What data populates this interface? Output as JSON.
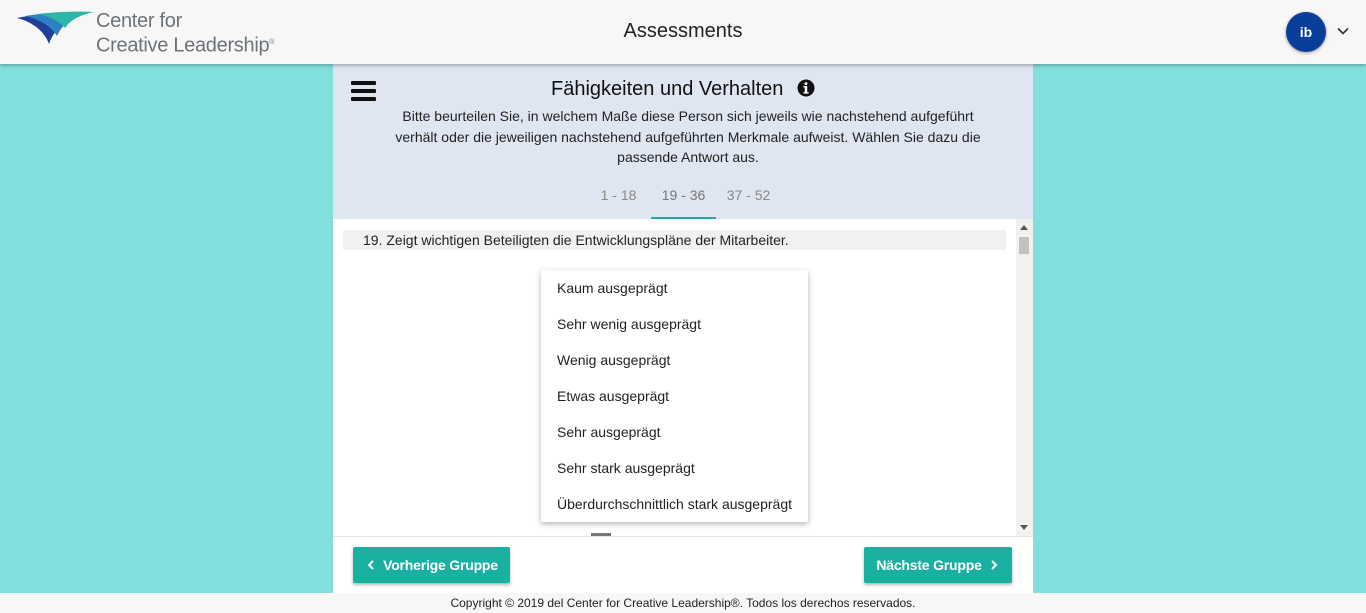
{
  "header": {
    "logo_line1": "Center for",
    "logo_line2": "Creative Leadership",
    "logo_mark": "®",
    "title": "Assessments",
    "avatar_initials": "ib",
    "menu_icon": "chevron-down-icon"
  },
  "section": {
    "title": "Fähigkeiten und Verhalten",
    "info_icon": "info-icon",
    "instructions": "Bitte beurteilen Sie, in welchem Maße diese Person sich jeweils wie nachstehend aufgeführt verhält oder die jeweiligen nachstehend aufgeführten Merkmale aufweist. Wählen Sie dazu die passende Antwort aus.",
    "tabs": [
      {
        "label": "1 - 18",
        "active": false
      },
      {
        "label": "19 - 36",
        "active": true
      },
      {
        "label": "37 - 52",
        "active": false
      }
    ]
  },
  "question": {
    "number": "19.",
    "text": "Zeigt wichtigen Beteiligten die Entwicklungspläne der Mitarbeiter."
  },
  "options": [
    "Kaum ausgeprägt",
    "Sehr wenig ausgeprägt",
    "Wenig ausgeprägt",
    "Etwas ausgeprägt",
    "Sehr ausgeprägt",
    "Sehr stark ausgeprägt",
    "Überdurchschnittlich stark ausgeprägt"
  ],
  "nav": {
    "prev_label": "Vorherige Gruppe",
    "next_label": "Nächste Gruppe"
  },
  "footer": {
    "copyright": "Copyright © 2019 del Center for Creative Leadership®. Todos los derechos reservados."
  },
  "colors": {
    "background": "#82e0dc",
    "accent": "#17b0a1",
    "avatar": "#0a3e9b",
    "panel_header": "#dfe6f2"
  }
}
